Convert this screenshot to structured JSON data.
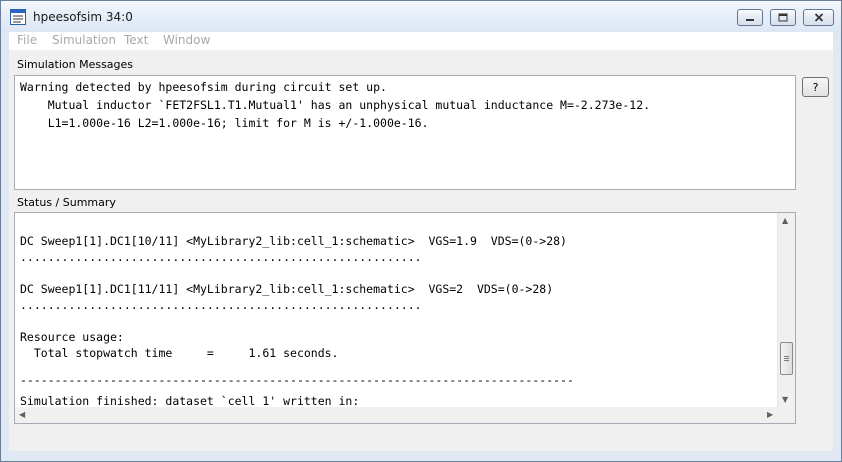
{
  "window": {
    "title": "hpeesofsim 34:0"
  },
  "menu": {
    "items": [
      "File",
      "Simulation",
      "Text",
      "Window"
    ]
  },
  "simulation_messages": {
    "label": "Simulation Messages",
    "lines": [
      "Warning detected by hpeesofsim during circuit set up.",
      "    Mutual inductor `FET2FSL1.T1.Mutual1' has an unphysical mutual inductance M=-2.273e-12.",
      "    L1=1.000e-16 L2=1.000e-16; limit for M is +/-1.000e-16."
    ],
    "help_button_label": "?"
  },
  "status_summary": {
    "label": "Status / Summary",
    "lines": [
      "DC Sweep1[1].DC1[10/11] <MyLibrary2_lib:cell_1:schematic>  VGS=1.9  VDS=(0->28)",
      "..........................................................",
      "",
      "DC Sweep1[1].DC1[11/11] <MyLibrary2_lib:cell_1:schematic>  VGS=2  VDS=(0->28)",
      "..........................................................",
      "",
      "Resource usage:",
      "  Total stopwatch time     =     1.61 seconds.",
      "",
      "--------------------------------------------------------------------------------",
      "Simulation finished: dataset `cell_1' written in:"
    ]
  }
}
